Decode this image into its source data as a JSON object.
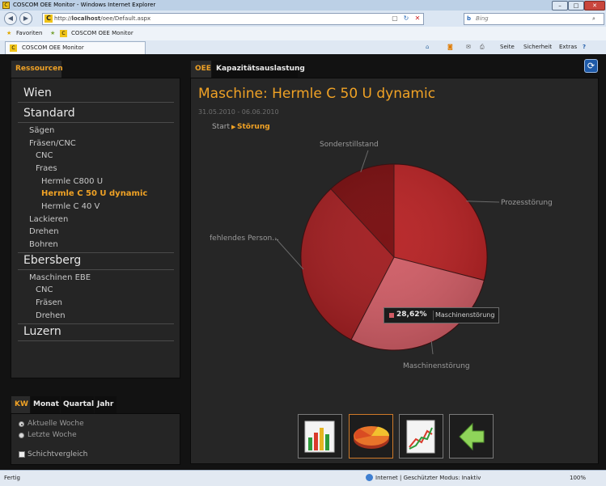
{
  "window": {
    "title": "COSCOM OEE Monitor - Windows Internet Explorer",
    "buttons": [
      "–",
      "□",
      "✕"
    ]
  },
  "addressbar": {
    "url_prefix": "http://",
    "url_host": "localhost",
    "url_path": "/oee/Default.aspx",
    "search_placeholder": "Bing"
  },
  "favorites": {
    "favorites_label": "Favoriten",
    "site_label": "COSCOM OEE Monitor"
  },
  "browser_tab": {
    "label": "COSCOM OEE Monitor"
  },
  "commandbar": {
    "seite": "Seite",
    "sicherheit": "Sicherheit",
    "extras": "Extras"
  },
  "statusbar": {
    "left": "Fertig",
    "zone": "Internet | Geschützter Modus: Inaktiv",
    "zoom": "100%"
  },
  "sidebar": {
    "tab_label": "Ressourcen",
    "tree": [
      {
        "label": "Wien",
        "level": 0
      },
      {
        "label": "Standard",
        "level": 0
      },
      {
        "label": "Sägen",
        "level": 1
      },
      {
        "label": "Fräsen/CNC",
        "level": 1
      },
      {
        "label": "CNC",
        "level": 2
      },
      {
        "label": "Fraes",
        "level": 2
      },
      {
        "label": "Hermle C800 U",
        "level": 3
      },
      {
        "label": "Hermle C 50 U dynamic",
        "level": 3,
        "selected": true
      },
      {
        "label": "Hermle C 40 V",
        "level": 3
      },
      {
        "label": "Lackieren",
        "level": 1
      },
      {
        "label": "Drehen",
        "level": 1
      },
      {
        "label": "Bohren",
        "level": 1
      },
      {
        "label": "Ebersberg",
        "level": 0
      },
      {
        "label": "Maschinen EBE",
        "level": 1
      },
      {
        "label": "CNC",
        "level": 2
      },
      {
        "label": "Fräsen",
        "level": 2
      },
      {
        "label": "Drehen",
        "level": 2
      },
      {
        "label": "Luzern",
        "level": 0
      }
    ]
  },
  "period": {
    "tabs": [
      "KW",
      "Monat",
      "Quartal",
      "Jahr"
    ],
    "active_tab": "KW",
    "options": [
      "Aktuelle Woche",
      "Letzte Woche"
    ],
    "selected_option": "Aktuelle Woche",
    "checkbox_label": "Schichtvergleich"
  },
  "main": {
    "tabs": [
      "OEE",
      "Kapazitätsauslastung"
    ],
    "active_tab": "OEE",
    "title": "Maschine: Hermle C 50 U dynamic",
    "date_range": "31.05.2010 - 06.06.2010",
    "breadcrumb_start": "Start",
    "breadcrumb_current": "Störung",
    "tooltip_value": "28,62%",
    "tooltip_label": "Maschinenstörung",
    "thumbnails": [
      "bar-chart-icon",
      "pie-chart-icon",
      "line-chart-icon",
      "back-arrow-icon"
    ]
  },
  "chart_data": {
    "type": "pie",
    "title": "",
    "series": [
      {
        "name": "Prozesstörung",
        "value": 29.0,
        "color": "#b51d1f"
      },
      {
        "name": "Maschinenstörung",
        "value": 28.62,
        "color": "#d05a63"
      },
      {
        "name": "fehlendes Person...",
        "value": 30.5,
        "color": "#9f181b"
      },
      {
        "name": "Sonderstillstand",
        "value": 11.88,
        "color": "#740608"
      }
    ],
    "label_texts": [
      "Prozesstörung",
      "Maschinenstörung",
      "fehlendes Person...",
      "Sonderstillstand"
    ]
  },
  "colors": {
    "accent": "#f0a225",
    "panel_bg": "#252525",
    "app_bg": "#121212"
  }
}
